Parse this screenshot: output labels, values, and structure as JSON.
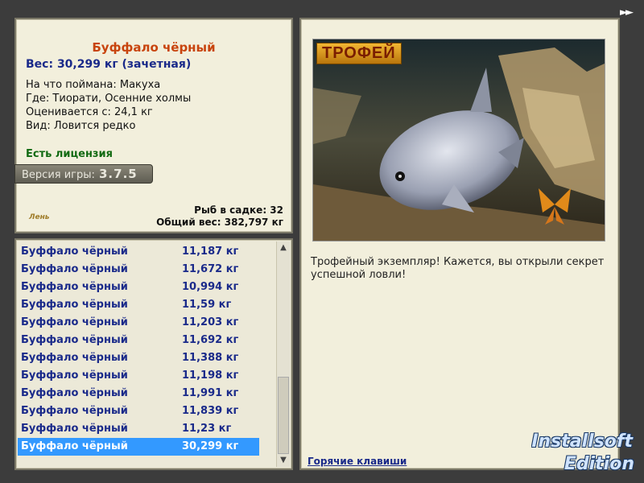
{
  "nav": {
    "forward_glyph": "►►"
  },
  "info": {
    "fish_name": "Буффало чёрный",
    "weight_line": "Вес: 30,299 кг (зачетная)",
    "caught_on": "На что поймана: Макуха",
    "location": "Где: Тиорати, Осенние холмы",
    "rated_from": "Оценивается с: 24,1 кг",
    "species_type": "Вид: Ловится редко",
    "license": "Есть лицензия",
    "version_label": "Версия игры:",
    "version_value": "3.7.5",
    "logo_text": "Лень",
    "fish_in_keepnet": "Рыб в садке: 32",
    "total_weight": "Общий вес: 382,797 кг"
  },
  "catch_list": [
    {
      "name": "Буффало чёрный",
      "weight": "11,187 кг"
    },
    {
      "name": "Буффало чёрный",
      "weight": "11,672 кг"
    },
    {
      "name": "Буффало чёрный",
      "weight": "10,994 кг"
    },
    {
      "name": "Буффало чёрный",
      "weight": "11,59 кг"
    },
    {
      "name": "Буффало чёрный",
      "weight": "11,203 кг"
    },
    {
      "name": "Буффало чёрный",
      "weight": "11,692 кг"
    },
    {
      "name": "Буффало чёрный",
      "weight": "11,388 кг"
    },
    {
      "name": "Буффало чёрный",
      "weight": "11,198 кг"
    },
    {
      "name": "Буффало чёрный",
      "weight": "11,991 кг"
    },
    {
      "name": "Буффало чёрный",
      "weight": "11,839 кг"
    },
    {
      "name": "Буффало чёрный",
      "weight": "11,23 кг"
    },
    {
      "name": "Буффало чёрный",
      "weight": "30,299 кг",
      "selected": true
    }
  ],
  "detail": {
    "trophy_badge": "ТРОФЕЙ",
    "caption": "Трофейный экземпляр! Кажется, вы открыли секрет успешной ловли!",
    "hotkeys_link": "Горячие клавиши"
  },
  "watermark": {
    "line1": "Installsoft",
    "line2": "Edition"
  },
  "colors": {
    "accent_red": "#c8440e",
    "accent_blue": "#1a2a8a",
    "license_green": "#126a12",
    "selection": "#3399ff"
  }
}
